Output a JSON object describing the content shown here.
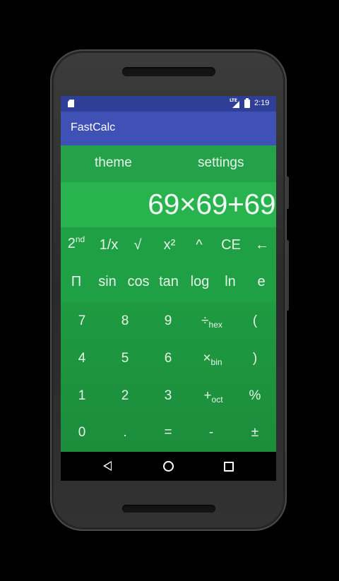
{
  "status_bar": {
    "time": "2:19",
    "network": "LTE",
    "icons": [
      "sd-card-icon",
      "signal-icon",
      "battery-icon"
    ]
  },
  "app_bar": {
    "title": "FastCalc"
  },
  "menu": {
    "theme": "theme",
    "settings": "settings"
  },
  "display": {
    "expression": "69×69+69"
  },
  "advanced_keys": {
    "row1": [
      {
        "base": "2",
        "sup": "nd"
      },
      {
        "label": "1/x"
      },
      {
        "label": "√"
      },
      {
        "label": "x²"
      },
      {
        "label": "^"
      },
      {
        "label": "CE"
      },
      {
        "label": "←"
      }
    ],
    "row2": [
      "Π",
      "sin",
      "cos",
      "tan",
      "log",
      "ln",
      "e"
    ]
  },
  "basic_keys": {
    "row1": [
      {
        "label": "7"
      },
      {
        "label": "8"
      },
      {
        "label": "9"
      },
      {
        "base": "÷",
        "sub": "hex"
      },
      {
        "label": "("
      }
    ],
    "row2": [
      {
        "label": "4"
      },
      {
        "label": "5"
      },
      {
        "label": "6"
      },
      {
        "base": "×",
        "sub": "bin"
      },
      {
        "label": ")"
      }
    ],
    "row3": [
      {
        "label": "1"
      },
      {
        "label": "2"
      },
      {
        "label": "3"
      },
      {
        "base": "+",
        "sub": "oct"
      },
      {
        "label": "%"
      }
    ],
    "row4": [
      {
        "label": "0"
      },
      {
        "label": "."
      },
      {
        "label": "="
      },
      {
        "label": "-"
      },
      {
        "label": "±"
      }
    ]
  },
  "nav_bar": {
    "icons": [
      "back-icon",
      "home-icon",
      "recents-icon"
    ]
  },
  "colors": {
    "status_bar": "#2f3f97",
    "app_bar": "#3f51b5",
    "menu_row": "#24a24a",
    "display": "#29b34f",
    "advanced_pad": "#20a044",
    "basic_pad": "#1e953f"
  }
}
